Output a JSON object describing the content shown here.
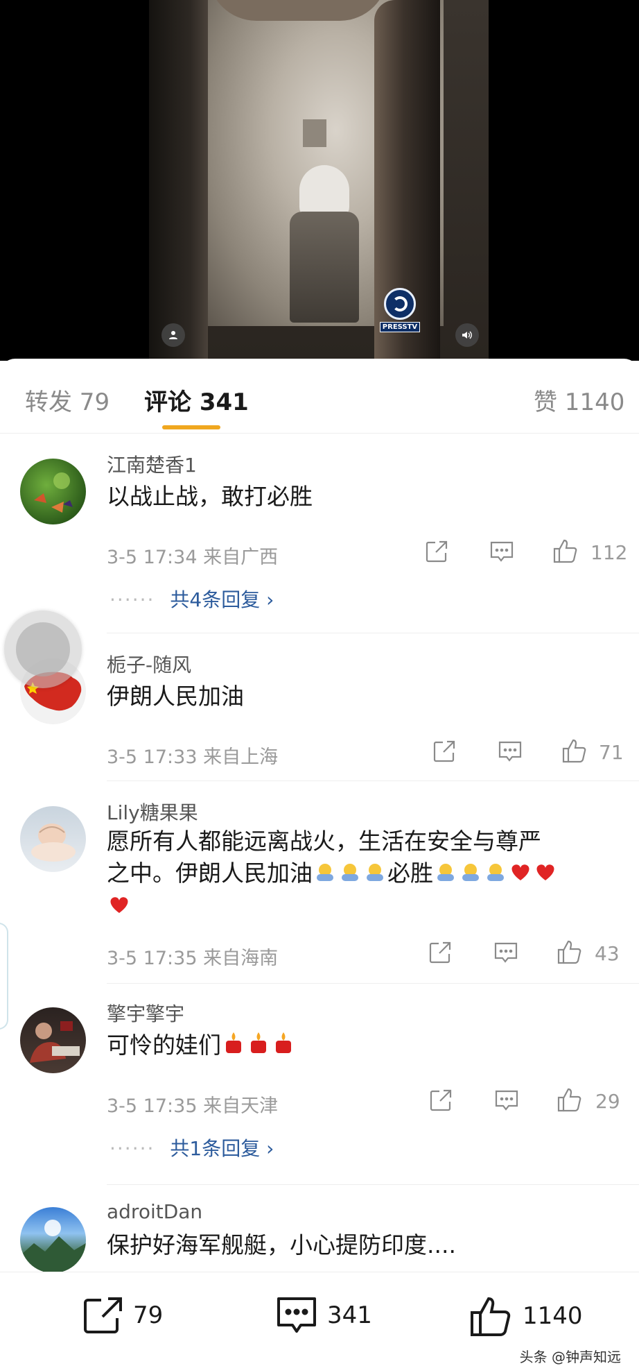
{
  "video": {
    "logo_text": "PRESSTV"
  },
  "tabs": {
    "repost": "转发 79",
    "comments": "评论 341",
    "likes": "赞 1140"
  },
  "comments": [
    {
      "username": "江南楚香1",
      "text": "以战止战，敢打必胜",
      "meta": "3-5 17:34  来自广西",
      "likes": "112",
      "replies": "共4条回复 ›"
    },
    {
      "username": "栀子-随风",
      "text": "伊朗人民加油",
      "meta": "3-5 17:33  来自上海",
      "likes": "71"
    },
    {
      "username": "Lily糖果果",
      "text_line1": "愿所有人都能远离战火，生活在安全与尊严",
      "text_line2_a": "之中。伊朗人民加油",
      "text_line2_b": "必胜",
      "meta": "3-5 17:35  来自海南",
      "likes": "43"
    },
    {
      "username": "擎宇擎宇",
      "text": "可怜的娃们",
      "meta": "3-5 17:35  来自天津",
      "likes": "29",
      "replies": "共1条回复 ›"
    },
    {
      "username": "adroitDan",
      "text": "保护好海军舰艇，小心提防印度...."
    }
  ],
  "bottom_bar": {
    "repost_count": "79",
    "comment_count": "341",
    "like_count": "1140"
  },
  "watermark": "头条 @钟声知远",
  "colors": {
    "accent_underline": "#f0a71f",
    "reply_link": "#2c5b9c"
  }
}
